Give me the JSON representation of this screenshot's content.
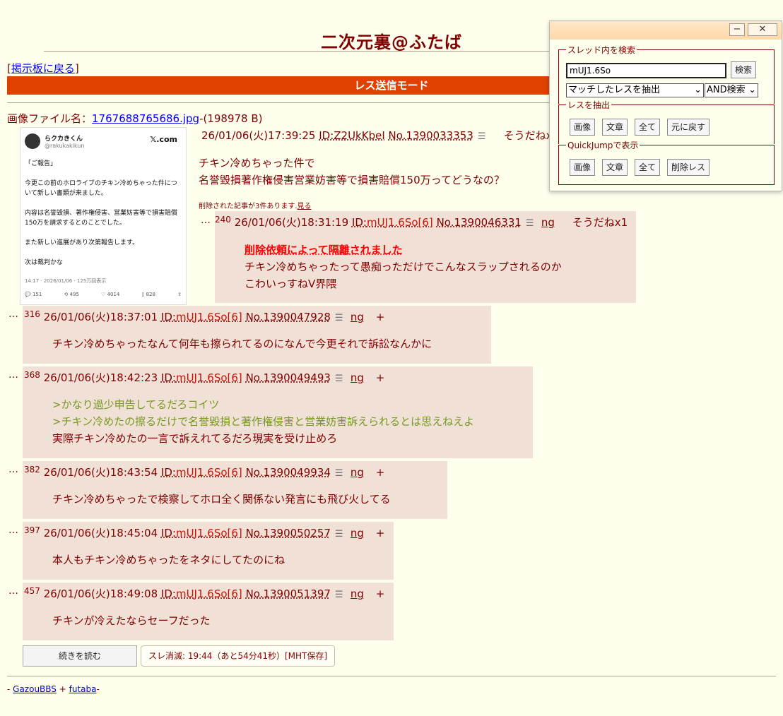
{
  "page": {
    "title": "二次元裏@ふたば",
    "back_link": "掲示板に戻る",
    "mode_bar": "レス送信モード"
  },
  "file": {
    "label": "画像ファイル名：",
    "name": "1767688765686.jpg",
    "size": "-(198978 B)"
  },
  "thumbnail": {
    "account_name": "らクカきくん",
    "handle": "@rakukakikun",
    "platform": "𝕏.com",
    "text": "「ご報告」\n\n今更この前のホロライブのチキン冷めちゃった件につ\nいて新しい書類が来ました。\n\n内容は名誉毀損、著作権侵害、営業妨害等で損害賠償\n150万を請求するとのことでした。\n\nまた新しい進展があり次第報告します。\n\n次は裁判かな",
    "meta": "14:17 · 2026/01/06 · 125万回表示",
    "stats": [
      "151",
      "495",
      "4014",
      "828"
    ]
  },
  "op": {
    "datetime": "26/01/06(火)17:39:25",
    "id": "ID:Z2UkKbeI",
    "no": "No.1390033353",
    "sodane": "そうだねx1",
    "lines": [
      "チキン冷めちゃった件で",
      "名誉毀損著作権侵害営業妨害等で損害賠償150万ってどうなの？"
    ],
    "deleted_note": "削除された記事が3件あります.",
    "deleted_link": "見る"
  },
  "replies": [
    {
      "n": "240",
      "datetime": "26/01/06(火)18:31:19",
      "id_prefix": "ID:",
      "id": "mUJ1.6So[6]",
      "no": "No.1390046331",
      "ng": "ng",
      "extra": "そうだねx1",
      "notice": "削除依頼によって隔離されました",
      "lines": [
        "チキン冷めちゃったって愚痴っただけでこんなスラップされるのか",
        "こわいっすねV界隈"
      ]
    },
    {
      "n": "316",
      "datetime": "26/01/06(火)18:37:01",
      "id_prefix": "ID:",
      "id": "mUJ1.6So[6]",
      "no": "No.1390047928",
      "ng": "ng",
      "extra": "+",
      "lines": [
        "チキン冷めちゃったなんて何年も擦られてるのになんで今更それで訴訟なんかに"
      ]
    },
    {
      "n": "368",
      "datetime": "26/01/06(火)18:42:23",
      "id_prefix": "ID:",
      "id": "mUJ1.6So[6]",
      "no": "No.1390049493",
      "ng": "ng",
      "extra": "+",
      "quotes": [
        ">かなり過少申告してるだろコイツ",
        ">チキン冷めたの擦るだけで名誉毀損と著作権侵害と営業妨害訴えられるとは思えねえよ"
      ],
      "lines": [
        "実際チキン冷めたの一言で訴えれてるだろ現実を受け止めろ"
      ]
    },
    {
      "n": "382",
      "datetime": "26/01/06(火)18:43:54",
      "id_prefix": "ID:",
      "id": "mUJ1.6So[6]",
      "no": "No.1390049934",
      "ng": "ng",
      "extra": "+",
      "lines": [
        "チキン冷めちゃったで検察してホロ全く関係ない発言にも飛び火してる"
      ]
    },
    {
      "n": "397",
      "datetime": "26/01/06(火)18:45:04",
      "id_prefix": "ID:",
      "id": "mUJ1.6So[6]",
      "no": "No.1390050257",
      "ng": "ng",
      "extra": "+",
      "lines": [
        "本人もチキン冷めちゃったをネタにしてたのにね"
      ]
    },
    {
      "n": "457",
      "datetime": "26/01/06(火)18:49:08",
      "id_prefix": "ID:",
      "id": "mUJ1.6So[6]",
      "no": "No.1390051397",
      "ng": "ng",
      "extra": "+",
      "lines": [
        "チキンが冷えたならセーフだった"
      ]
    }
  ],
  "bottom": {
    "more_button": "続きを読む",
    "expire": "スレ消滅: 19:44（あと54分41秒）[MHT保存]"
  },
  "footer": {
    "prefix": "- ",
    "link1": "GazouBBS",
    "sep": " + ",
    "link2": "futaba",
    "suffix": "-"
  },
  "search_panel": {
    "minimize": "−",
    "close": "✕",
    "search_legend": "スレッド内を検索",
    "query": "mUJ1.6So",
    "search_button": "検索",
    "mode_select": "マッチしたレスを抽出",
    "logic_select": "AND検索",
    "extract_legend": "レスを抽出",
    "extract_buttons": [
      "画像",
      "文章",
      "全て",
      "元に戻す"
    ],
    "jump_legend": "QuickJumpで表示",
    "jump_buttons": [
      "画像",
      "文章",
      "全て",
      "削除レス"
    ]
  }
}
